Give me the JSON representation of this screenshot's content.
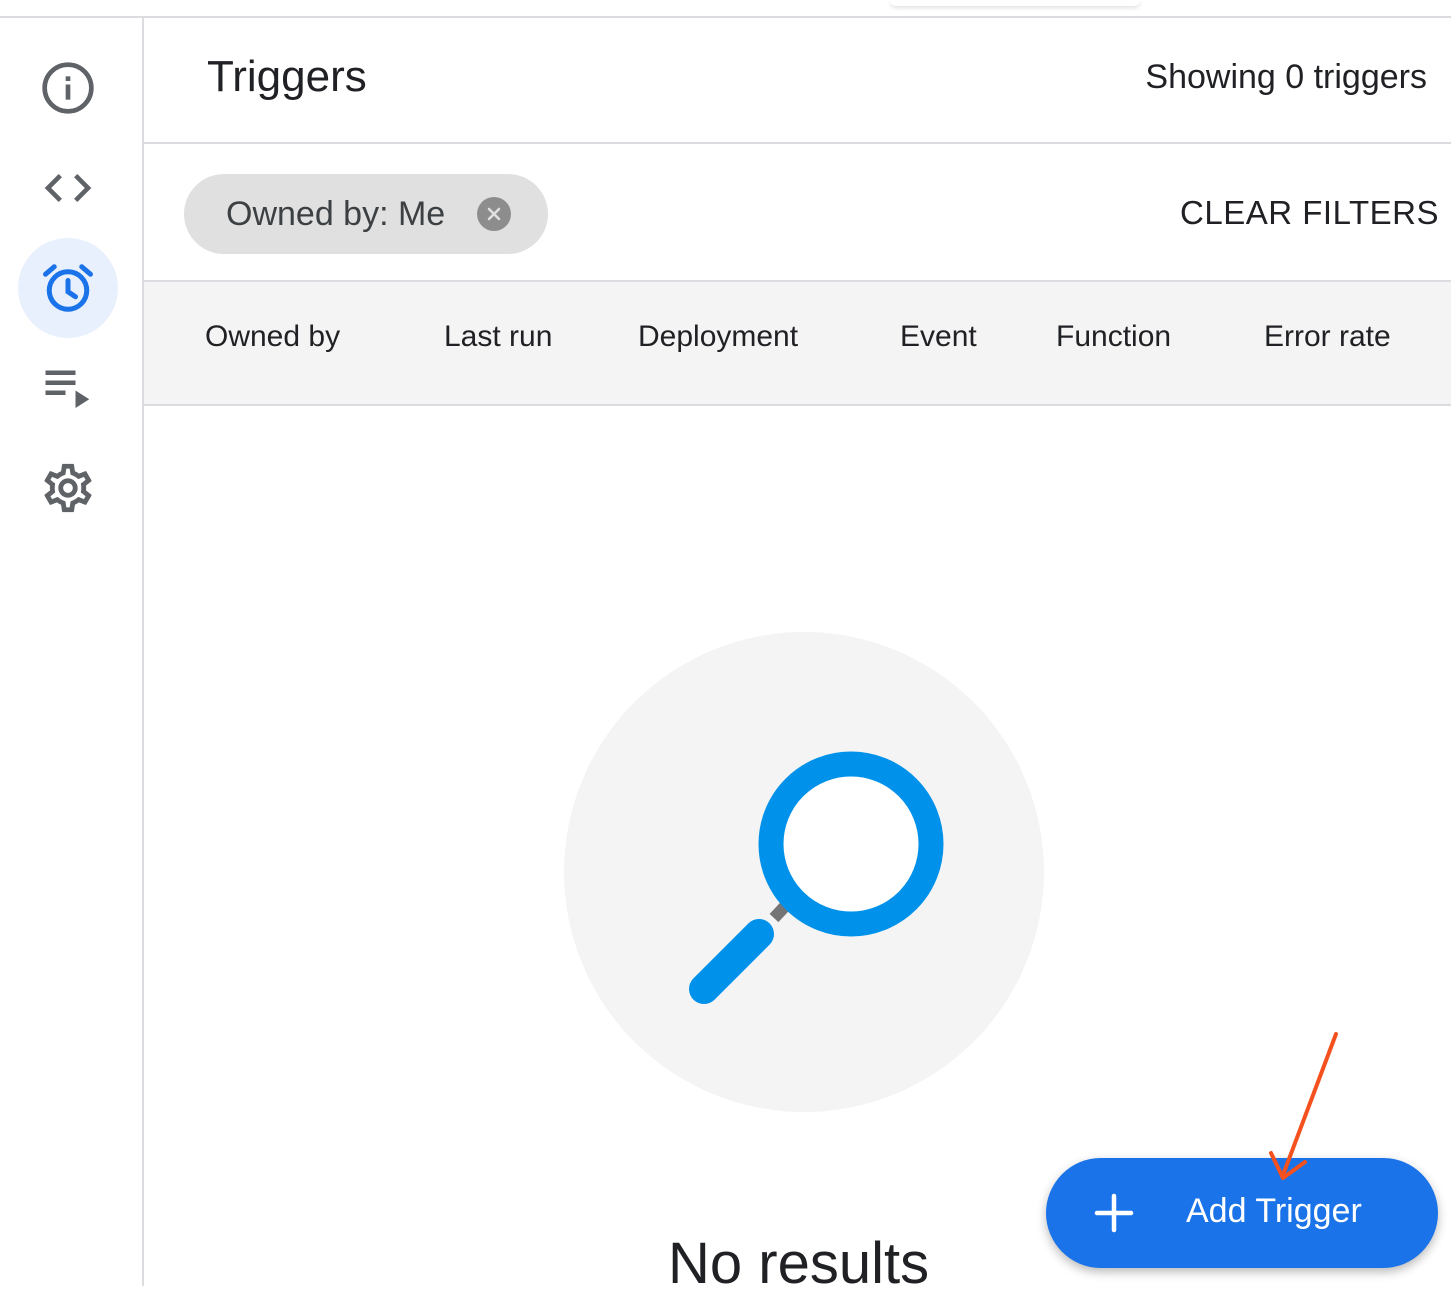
{
  "header": {
    "title": "Triggers",
    "showing_count": "Showing 0 triggers"
  },
  "sidebar": {
    "items": [
      {
        "name": "overview",
        "icon": "info-icon",
        "active": false
      },
      {
        "name": "editor",
        "icon": "code-icon",
        "active": false
      },
      {
        "name": "triggers",
        "icon": "alarm-clock-icon",
        "active": true
      },
      {
        "name": "executions",
        "icon": "playlist-play-icon",
        "active": false
      },
      {
        "name": "settings",
        "icon": "gear-icon",
        "active": false
      }
    ]
  },
  "filters": {
    "chip_label": "Owned by: Me",
    "clear_label": "CLEAR FILTERS"
  },
  "table": {
    "columns": [
      "Owned by",
      "Last run",
      "Deployment",
      "Event",
      "Function",
      "Error rate"
    ]
  },
  "empty_state": {
    "icon": "magnifier-icon",
    "message": "No results"
  },
  "fab": {
    "label": "Add Trigger",
    "icon": "plus-icon"
  },
  "colors": {
    "accent": "#1a73e8",
    "active_nav_bg": "#e8f0fe",
    "magnifier": "#0091ea",
    "annotation_arrow": "#f4511e"
  }
}
